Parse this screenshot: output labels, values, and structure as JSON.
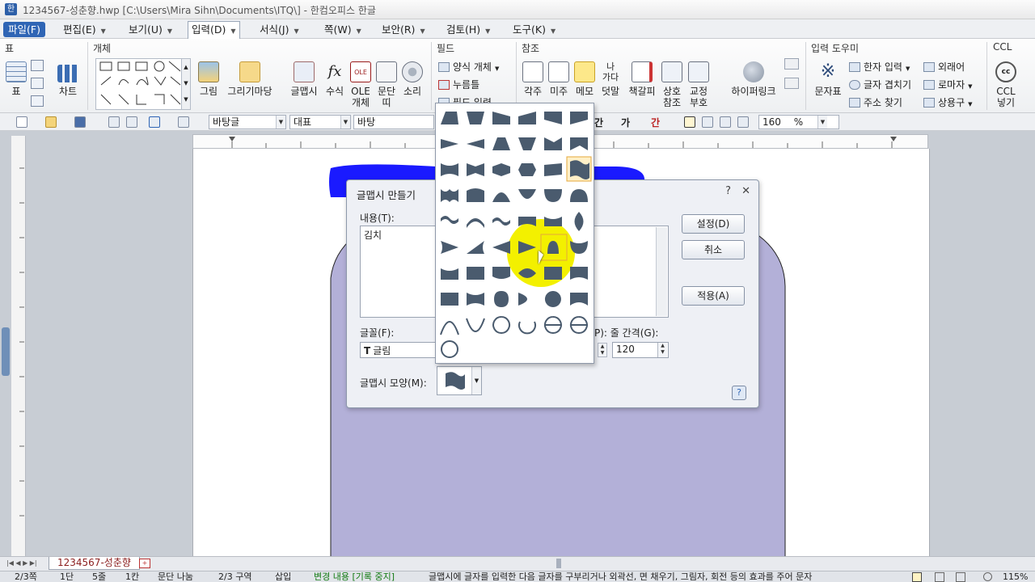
{
  "window": {
    "title": "1234567-성춘향.hwp [C:\\Users\\Mira Sihn\\Documents\\ITQ\\] - 한컴오피스 한글"
  },
  "menubar": {
    "items": [
      {
        "label": "파일(F)"
      },
      {
        "label": "편집(E)"
      },
      {
        "label": "보기(U)"
      },
      {
        "label": "입력(D)"
      },
      {
        "label": "서식(J)"
      },
      {
        "label": "쪽(W)"
      },
      {
        "label": "보안(R)"
      },
      {
        "label": "검토(H)"
      },
      {
        "label": "도구(K)"
      }
    ]
  },
  "ribbon": {
    "groups": {
      "table": "표",
      "object": "개체",
      "field": "필드",
      "reference": "참조",
      "input_helper": "입력 도우미",
      "ccl": "CCL"
    },
    "buttons": {
      "table": "표",
      "chart": "차트",
      "picture": "그림",
      "drawing": "그리기마당",
      "wordart": "글맵시",
      "formula": "수식",
      "ole1": "OLE",
      "ole2": "개체",
      "divider1": "문단",
      "divider2": "띠",
      "sound": "소리",
      "footnote": "각주",
      "endnote": "미주",
      "memo": "메모",
      "annotation": "덧말",
      "bookmark": "책갈피",
      "crossref1": "상호",
      "crossref2": "참조",
      "proof1": "교정",
      "proof2": "부호",
      "hyperlink": "하이퍼링크",
      "charmap": "문자표",
      "ccl1": "CCL",
      "ccl2": "넣기"
    },
    "field_items": [
      "양식 개체",
      "누름틀",
      "필드 입력"
    ],
    "helper_col1": [
      "한자 입력",
      "글자 겹치기",
      "주소 찾기"
    ],
    "helper_col2": [
      "외래어",
      "로마자",
      "상용구"
    ]
  },
  "toolbar": {
    "style": "바탕글",
    "language": "대표",
    "font": "바탕",
    "zoom": "160",
    "zoom_unit": "%",
    "char_tools": [
      "간",
      "가",
      "간"
    ]
  },
  "dialog": {
    "title": "글맵시 만들기",
    "content_label": "내용(T):",
    "content_value": "김치",
    "font_label": "글꼴(F):",
    "font_value": "글림",
    "line_spacing_label": "P): 줄 간격(G):",
    "line_spacing_value": "120",
    "shape_label": "글맵시 모양(M):",
    "buttons": {
      "ok": "설정(D)",
      "cancel": "취소",
      "apply": "적용(A)"
    },
    "help": "?",
    "close": "✕"
  },
  "doc_tab": {
    "label": "1234567-성춘향"
  },
  "statusbar": {
    "items": [
      "2/3쪽",
      "1단",
      "5줄",
      "1칸",
      "문단 나눔",
      "2/3 구역",
      "삽입"
    ],
    "track": "변경 내용 [기록 중지]",
    "message": "글맵시에 글자를 입력한 다음 글자를 구부리거나 외곽선, 면 채우기, 그림자, 회전 등의 효과를 주어 문자",
    "zoom": "115%"
  },
  "colors": {
    "shape_fill": "#4a5b6e",
    "highlight": "#f3f000",
    "page_shape": "#b3b0d8",
    "blue_shape": "#1a1aff",
    "accent": "#2f65b5",
    "status_green": "#127a12"
  }
}
